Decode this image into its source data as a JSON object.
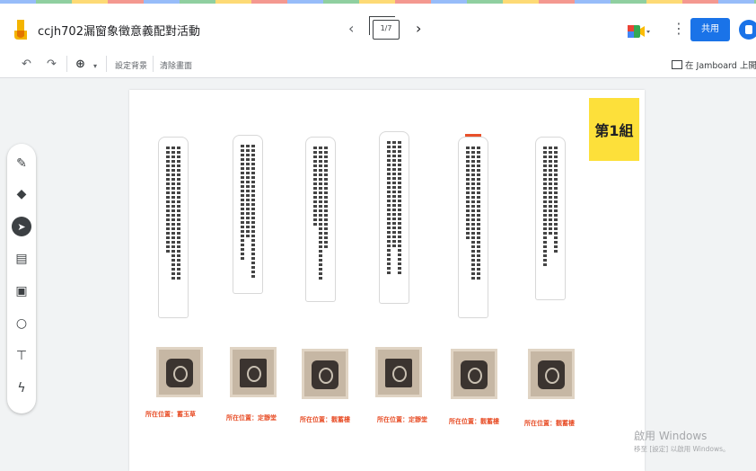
{
  "app": {
    "title": "ccjh702漏窗象徵意義配對活動",
    "frame_indicator": "1/7",
    "share_label": "共用"
  },
  "toolbar": {
    "set_background": "設定背景",
    "clear_frame": "清除畫面",
    "open_in_jamboard": "在 Jamboard 上開啟"
  },
  "board": {
    "sticky_label": "第1組",
    "captions": [
      "所在位置：蓄玉草",
      "所在位置：定靜堂",
      "所在位置：觀蓄樓",
      "所在位置：定靜堂",
      "所在位置：觀蓄樓",
      "所在位置：觀蓄樓"
    ]
  },
  "watermark": {
    "line1": "啟用 Windows",
    "line2": "移至 [設定] 以啟用 Windows。"
  },
  "colors": {
    "share_button": "#1a73e8",
    "sticky_note": "#fde03a",
    "caption": "#e8502a"
  }
}
